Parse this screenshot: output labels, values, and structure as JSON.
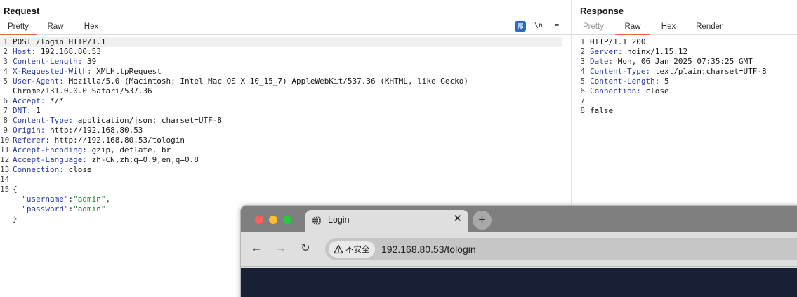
{
  "request": {
    "title": "Request",
    "tabs": [
      {
        "label": "Pretty"
      },
      {
        "label": "Raw"
      },
      {
        "label": "Hex"
      }
    ],
    "toolbar": {
      "newline_label": "\\n",
      "menu_glyph": "≡"
    },
    "lines": [
      {
        "n": "1",
        "text": "POST /login HTTP/1.1"
      },
      {
        "n": "2",
        "name": "Host:",
        "value": " 192.168.80.53"
      },
      {
        "n": "3",
        "name": "Content-Length:",
        "value": " 39"
      },
      {
        "n": "4",
        "name": "X-Requested-With:",
        "value": " XMLHttpRequest"
      },
      {
        "n": "5",
        "name": "User-Agent:",
        "value": " Mozilla/5.0 (Macintosh; Intel Mac OS X 10_15_7) AppleWebKit/537.36 (KHTML, like Gecko)"
      },
      {
        "n": "",
        "text": "Chrome/131.0.0.0 Safari/537.36"
      },
      {
        "n": "6",
        "name": "Accept:",
        "value": " */*"
      },
      {
        "n": "7",
        "name": "DNT:",
        "value": " 1"
      },
      {
        "n": "8",
        "name": "Content-Type:",
        "value": " application/json; charset=UTF-8"
      },
      {
        "n": "9",
        "name": "Origin:",
        "value": " http://192.168.80.53"
      },
      {
        "n": "10",
        "name": "Referer:",
        "value": " http://192.168.80.53/tologin"
      },
      {
        "n": "11",
        "name": "Accept-Encoding:",
        "value": " gzip, deflate, br"
      },
      {
        "n": "12",
        "name": "Accept-Language:",
        "value": " zh-CN,zh;q=0.9,en;q=0.8"
      },
      {
        "n": "13",
        "name": "Connection:",
        "value": " close"
      },
      {
        "n": "14",
        "text": ""
      },
      {
        "n": "15",
        "text": "{"
      },
      {
        "n": "",
        "key": "  \"username\"",
        "sep": ":",
        "str": "\"admin\"",
        "tail": ","
      },
      {
        "n": "",
        "key": "  \"password\"",
        "sep": ":",
        "str": "\"admin\"",
        "tail": ""
      },
      {
        "n": "",
        "text": "}"
      }
    ]
  },
  "response": {
    "title": "Response",
    "tabs": [
      {
        "label": "Pretty"
      },
      {
        "label": "Raw"
      },
      {
        "label": "Hex"
      },
      {
        "label": "Render"
      }
    ],
    "lines": [
      {
        "n": "1",
        "text": "HTTP/1.1 200"
      },
      {
        "n": "2",
        "name": "Server:",
        "value": " nginx/1.15.12"
      },
      {
        "n": "3",
        "name": "Date:",
        "value": " Mon, 06 Jan 2025 07:35:25 GMT"
      },
      {
        "n": "4",
        "name": "Content-Type:",
        "value": " text/plain;charset=UTF-8"
      },
      {
        "n": "5",
        "name": "Content-Length:",
        "value": " 5"
      },
      {
        "n": "6",
        "name": "Connection:",
        "value": " close"
      },
      {
        "n": "7",
        "text": ""
      },
      {
        "n": "8",
        "text": "false"
      }
    ]
  },
  "browser": {
    "tab_title": "Login",
    "tab_close": "✕",
    "new_tab": "+",
    "back": "←",
    "forward": "→",
    "reload": "↻",
    "security_label": "不安全",
    "url": "192.168.80.53/tologin"
  },
  "colors": {
    "accent": "#e8673c",
    "header_name": "#2a3a9c",
    "json_string": "#1c7d2b",
    "page_background": "#172035"
  }
}
